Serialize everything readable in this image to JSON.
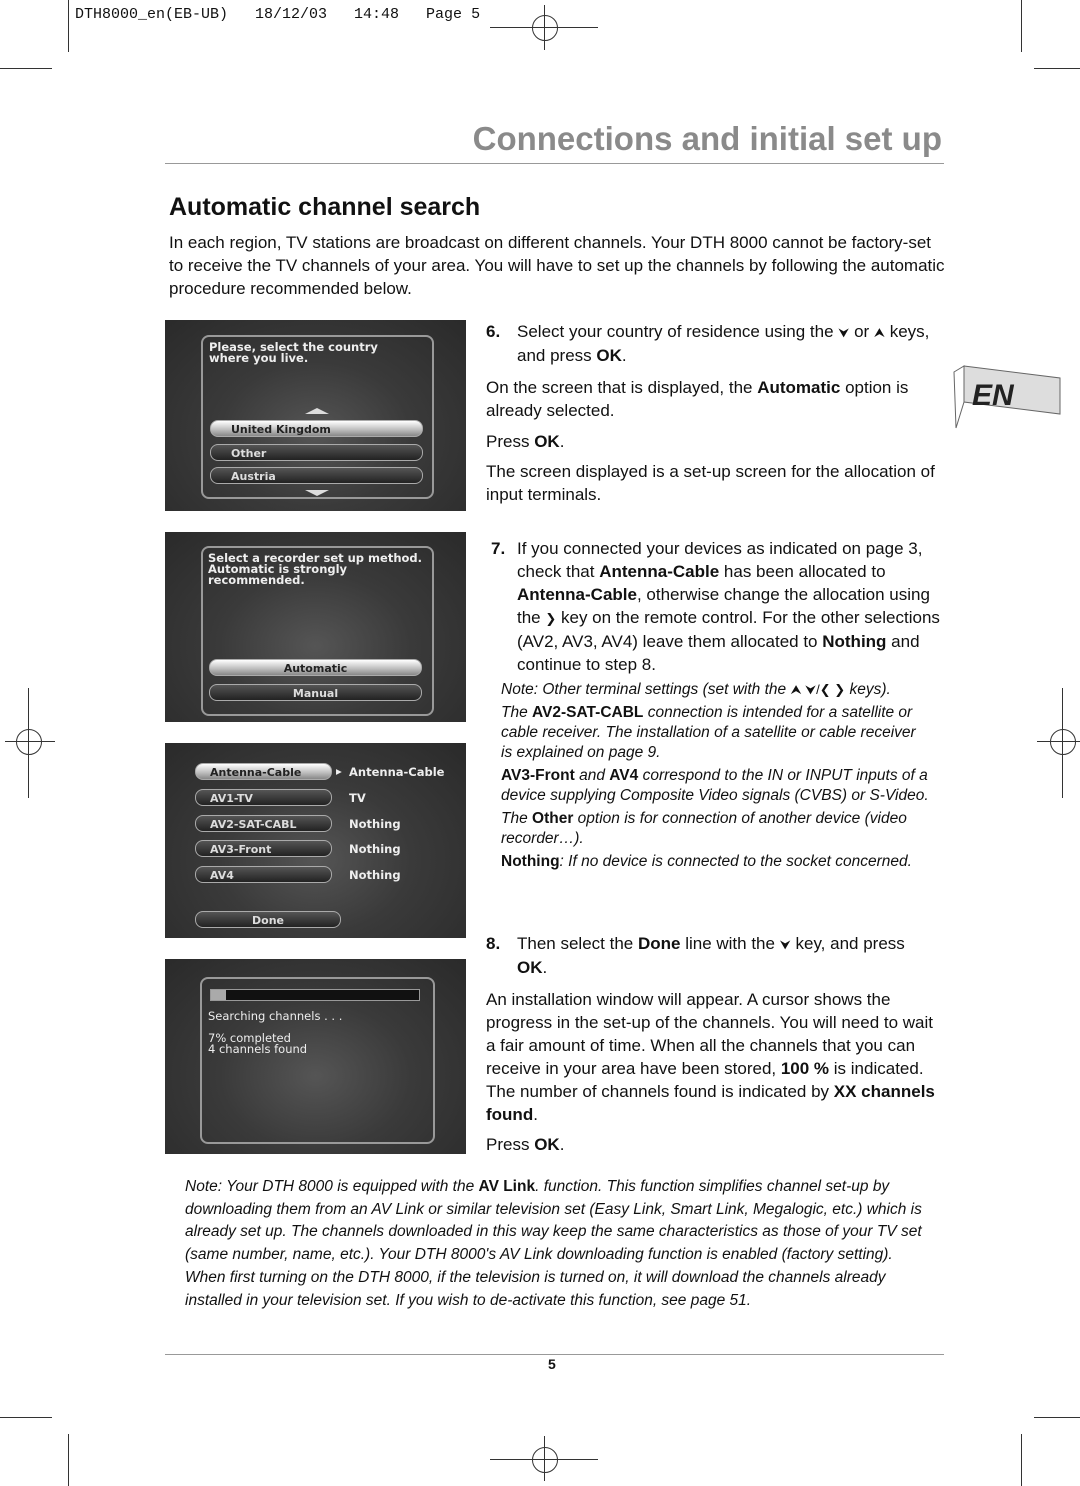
{
  "print_header": "DTH8000_en(EB-UB)   18/12/03   14:48   Page 5",
  "title": "Connections and initial set up",
  "section_title": "Automatic channel search",
  "intro": "In each region, TV stations are broadcast on different channels. Your DTH 8000 cannot be factory-set to receive the TV channels of your area. You will have to set up the channels by following the automatic procedure recommended below.",
  "language_badge": "EN",
  "screens": {
    "country": {
      "prompt": "Please, select the country where you live.",
      "options": [
        "United Kingdom",
        "Other",
        "Austria"
      ],
      "selected": 0
    },
    "method": {
      "prompt": "Select a recorder set up method. Automatic is strongly recommended.",
      "options": [
        "Automatic",
        "Manual"
      ],
      "selected": 0
    },
    "allocation": {
      "rows": [
        {
          "input": "Antenna-Cable",
          "value": "Antenna-Cable"
        },
        {
          "input": "AV1-TV",
          "value": "TV"
        },
        {
          "input": "AV2-SAT-CABL",
          "value": "Nothing"
        },
        {
          "input": "AV3-Front",
          "value": "Nothing"
        },
        {
          "input": "AV4",
          "value": "Nothing"
        }
      ],
      "done": "Done"
    },
    "search": {
      "status": "Searching channels . . .",
      "progress_text": "7% completed",
      "found": "4 channels found",
      "progress": 0.07
    }
  },
  "step6": {
    "num": "6.",
    "runs": [
      [
        "Select your country of residence using the ",
        ""
      ],
      [
        "⮟",
        "i"
      ],
      [
        " or ",
        ""
      ],
      [
        "⮝",
        "i"
      ],
      [
        " keys, and press ",
        ""
      ],
      [
        "OK",
        "b"
      ],
      [
        ".",
        ""
      ]
    ],
    "p2": [
      [
        "On the screen that is displayed, the ",
        ""
      ],
      [
        "Automatic",
        "b"
      ],
      [
        " option is already selected.",
        ""
      ]
    ],
    "p3": [
      [
        "Press ",
        ""
      ],
      [
        "OK",
        "b"
      ],
      [
        ".",
        ""
      ]
    ],
    "p4": [
      [
        "The screen displayed is a set-up screen for the allocation of input terminals.",
        ""
      ]
    ]
  },
  "step7": {
    "num": "7.",
    "runs": [
      [
        "If you connected your devices as indicated on page 3, check that ",
        ""
      ],
      [
        "Antenna-Cable",
        "b"
      ],
      [
        " has been allocated to ",
        ""
      ],
      [
        "Antenna-Cable",
        "b"
      ],
      [
        ", otherwise change the allocation using the ",
        ""
      ],
      [
        "❯",
        "i"
      ],
      [
        " key on the remote control. For the other selections (AV2, AV3, AV4) leave them allocated to ",
        ""
      ],
      [
        "Nothing",
        "b"
      ],
      [
        " and continue to step 8.",
        ""
      ]
    ],
    "notes": [
      [
        [
          "Note: Other terminal settings (set with the ",
          ""
        ],
        [
          "⮝ ⮟/❮ ❯",
          "i"
        ],
        [
          " keys).",
          ""
        ]
      ],
      [
        [
          "The ",
          ""
        ],
        [
          "AV2-SAT-CABL",
          "b"
        ],
        [
          " connection is intended for a satellite or cable receiver. The installation of a satellite or cable receiver is explained on page 9.",
          ""
        ]
      ],
      [
        [
          "AV3-Front",
          "b"
        ],
        [
          " and ",
          ""
        ],
        [
          "AV4",
          "b"
        ],
        [
          " correspond to the IN or INPUT inputs of a device supplying Composite Video signals (CVBS) or S-Video.",
          ""
        ]
      ],
      [
        [
          "The ",
          ""
        ],
        [
          "Other",
          "b"
        ],
        [
          " option is for connection of another device (video recorder…).",
          ""
        ]
      ],
      [
        [
          "Nothing",
          "b"
        ],
        [
          ": If no device is connected to the socket concerned.",
          ""
        ]
      ]
    ]
  },
  "step8": {
    "num": "8.",
    "runs": [
      [
        "Then select the ",
        ""
      ],
      [
        "Done",
        "b"
      ],
      [
        " line with the ",
        ""
      ],
      [
        "⮟",
        "i"
      ],
      [
        " key, and press ",
        ""
      ],
      [
        "OK",
        "b"
      ],
      [
        ".",
        ""
      ]
    ],
    "p2": [
      [
        "An installation window will appear. A cursor shows the progress in the set-up of the channels. You will need to wait a fair amount of time. When all the channels that you can receive in your area have been stored, ",
        ""
      ],
      [
        "100 %",
        "b"
      ],
      [
        " is indicated. The number of channels found is indicated by ",
        ""
      ],
      [
        "XX channels found",
        "b"
      ],
      [
        ".",
        ""
      ]
    ],
    "p3": [
      [
        "Press ",
        ""
      ],
      [
        "OK",
        "b"
      ],
      [
        ".",
        ""
      ]
    ]
  },
  "footnote": [
    [
      "Note: Your DTH 8000 is equipped with the ",
      ""
    ],
    [
      "AV Link",
      "b"
    ],
    [
      ". function. This function simplifies channel set-up by downloading them from an AV Link or similar television set (Easy Link, Smart Link, Megalogic, etc.) which is already set up. The channels downloaded in this way keep the same characteristics as those of your TV set (same number, name, etc.). Your DTH 8000's AV Link downloading function is enabled (factory setting). When first turning on the DTH 8000, if the television is turned on, it will download the channels already installed in your television set. If you wish to de-activate this function, see page 51.",
      ""
    ]
  ],
  "page_number": "5"
}
